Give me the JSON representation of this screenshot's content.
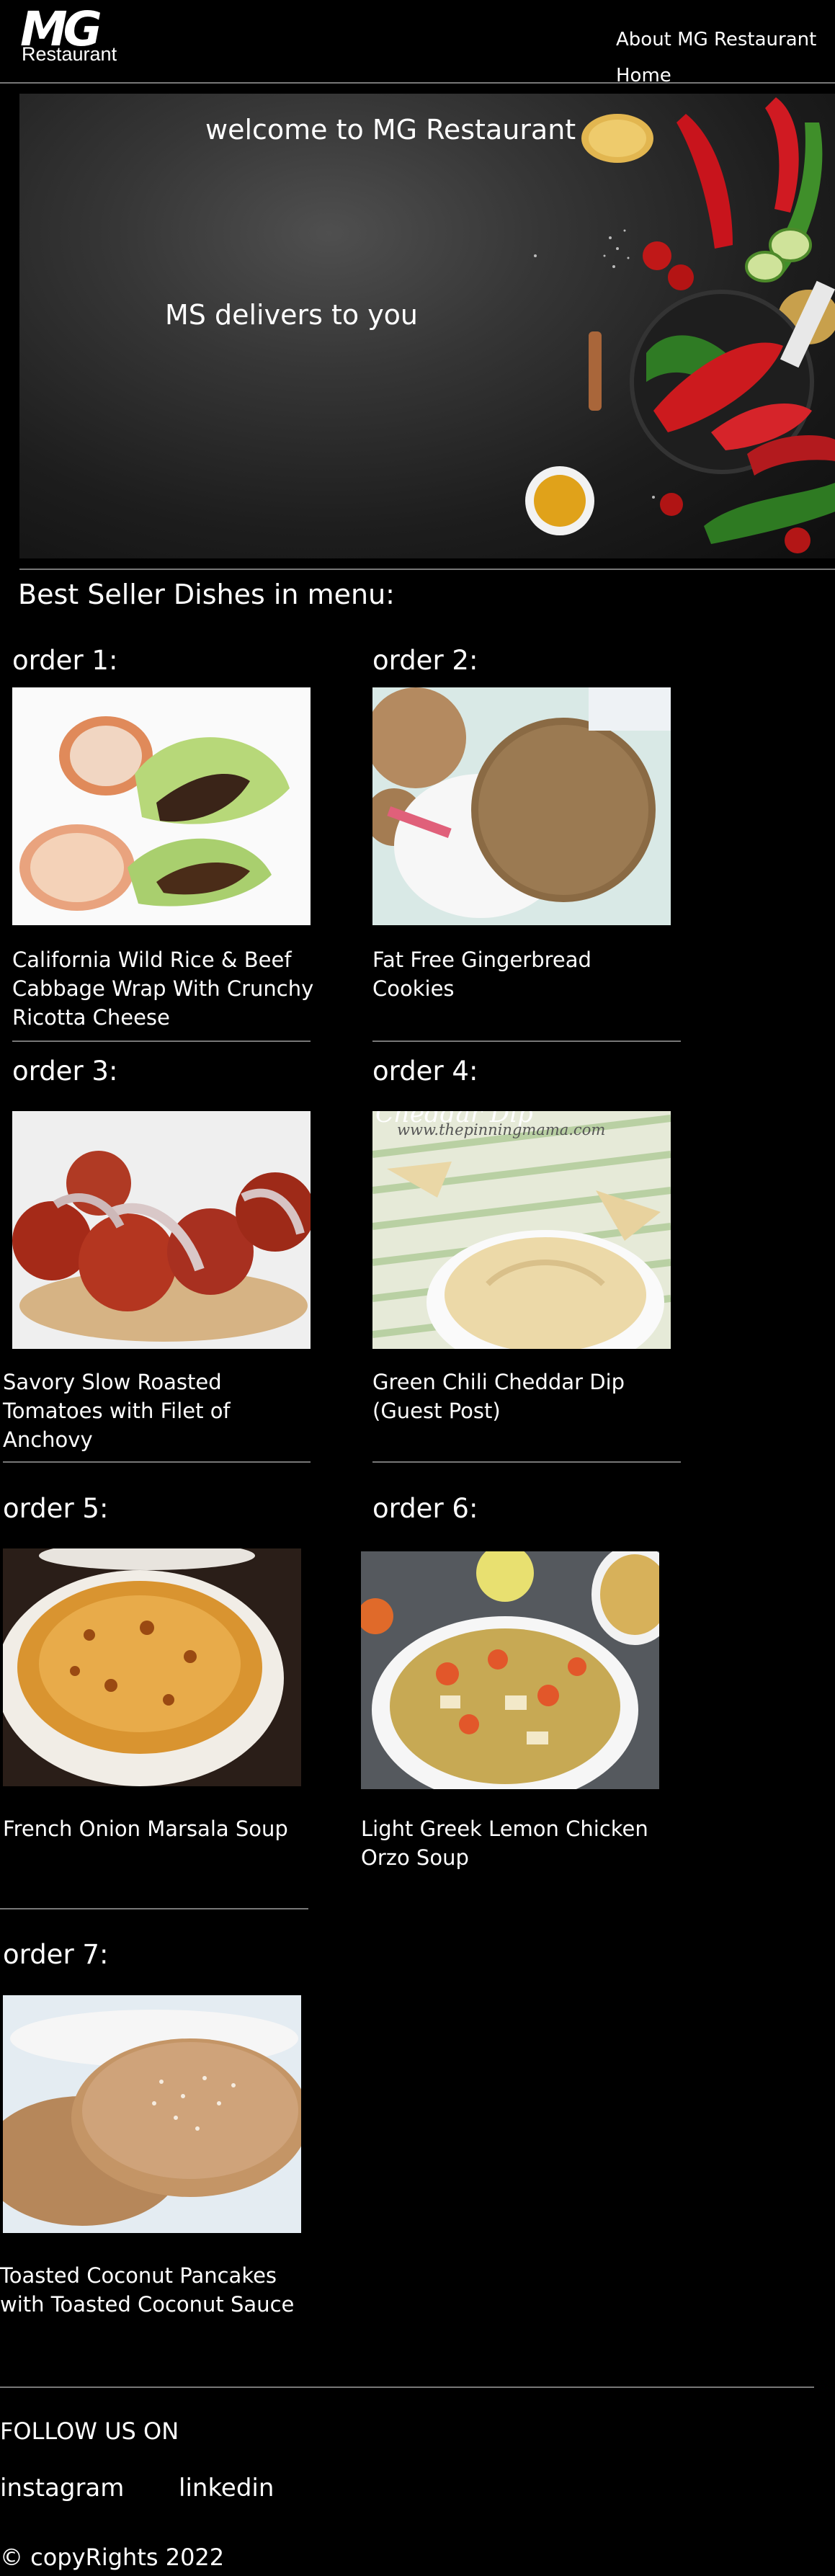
{
  "header": {
    "logo_big": "MG",
    "logo_sub": "Restaurant",
    "nav": [
      "About MG Restaurant",
      "Home"
    ]
  },
  "hero": {
    "title": "welcome to MG Restaurant",
    "subtitle": "MS delivers to you"
  },
  "menu": {
    "title": "Best Seller Dishes in menu:",
    "orders": [
      {
        "label": "order 1:",
        "name": "California Wild Rice & Beef Cabbage Wrap With Crunchy Ricotta Cheese"
      },
      {
        "label": "order 2:",
        "name": "Fat Free Gingerbread Cookies"
      },
      {
        "label": "order 3:",
        "name": "Savory Slow Roasted Tomatoes with Filet of Anchovy"
      },
      {
        "label": "order 4:",
        "name": "Green Chili Cheddar Dip (Guest Post)"
      },
      {
        "label": "order 5:",
        "name": "French Onion Marsala Soup"
      },
      {
        "label": "order 6:",
        "name": "Light Greek Lemon Chicken Orzo Soup"
      },
      {
        "label": "order 7:",
        "name": "Toasted Coconut Pancakes with Toasted Coconut Sauce"
      }
    ],
    "photo_watermark": "www.thepinningmama.com",
    "photo_caption": "Cheddar Dip"
  },
  "footer": {
    "follow": "FOLLOW US ON",
    "links": [
      "instagram",
      "linkedin"
    ],
    "copyright": "© copyRights 2022"
  }
}
